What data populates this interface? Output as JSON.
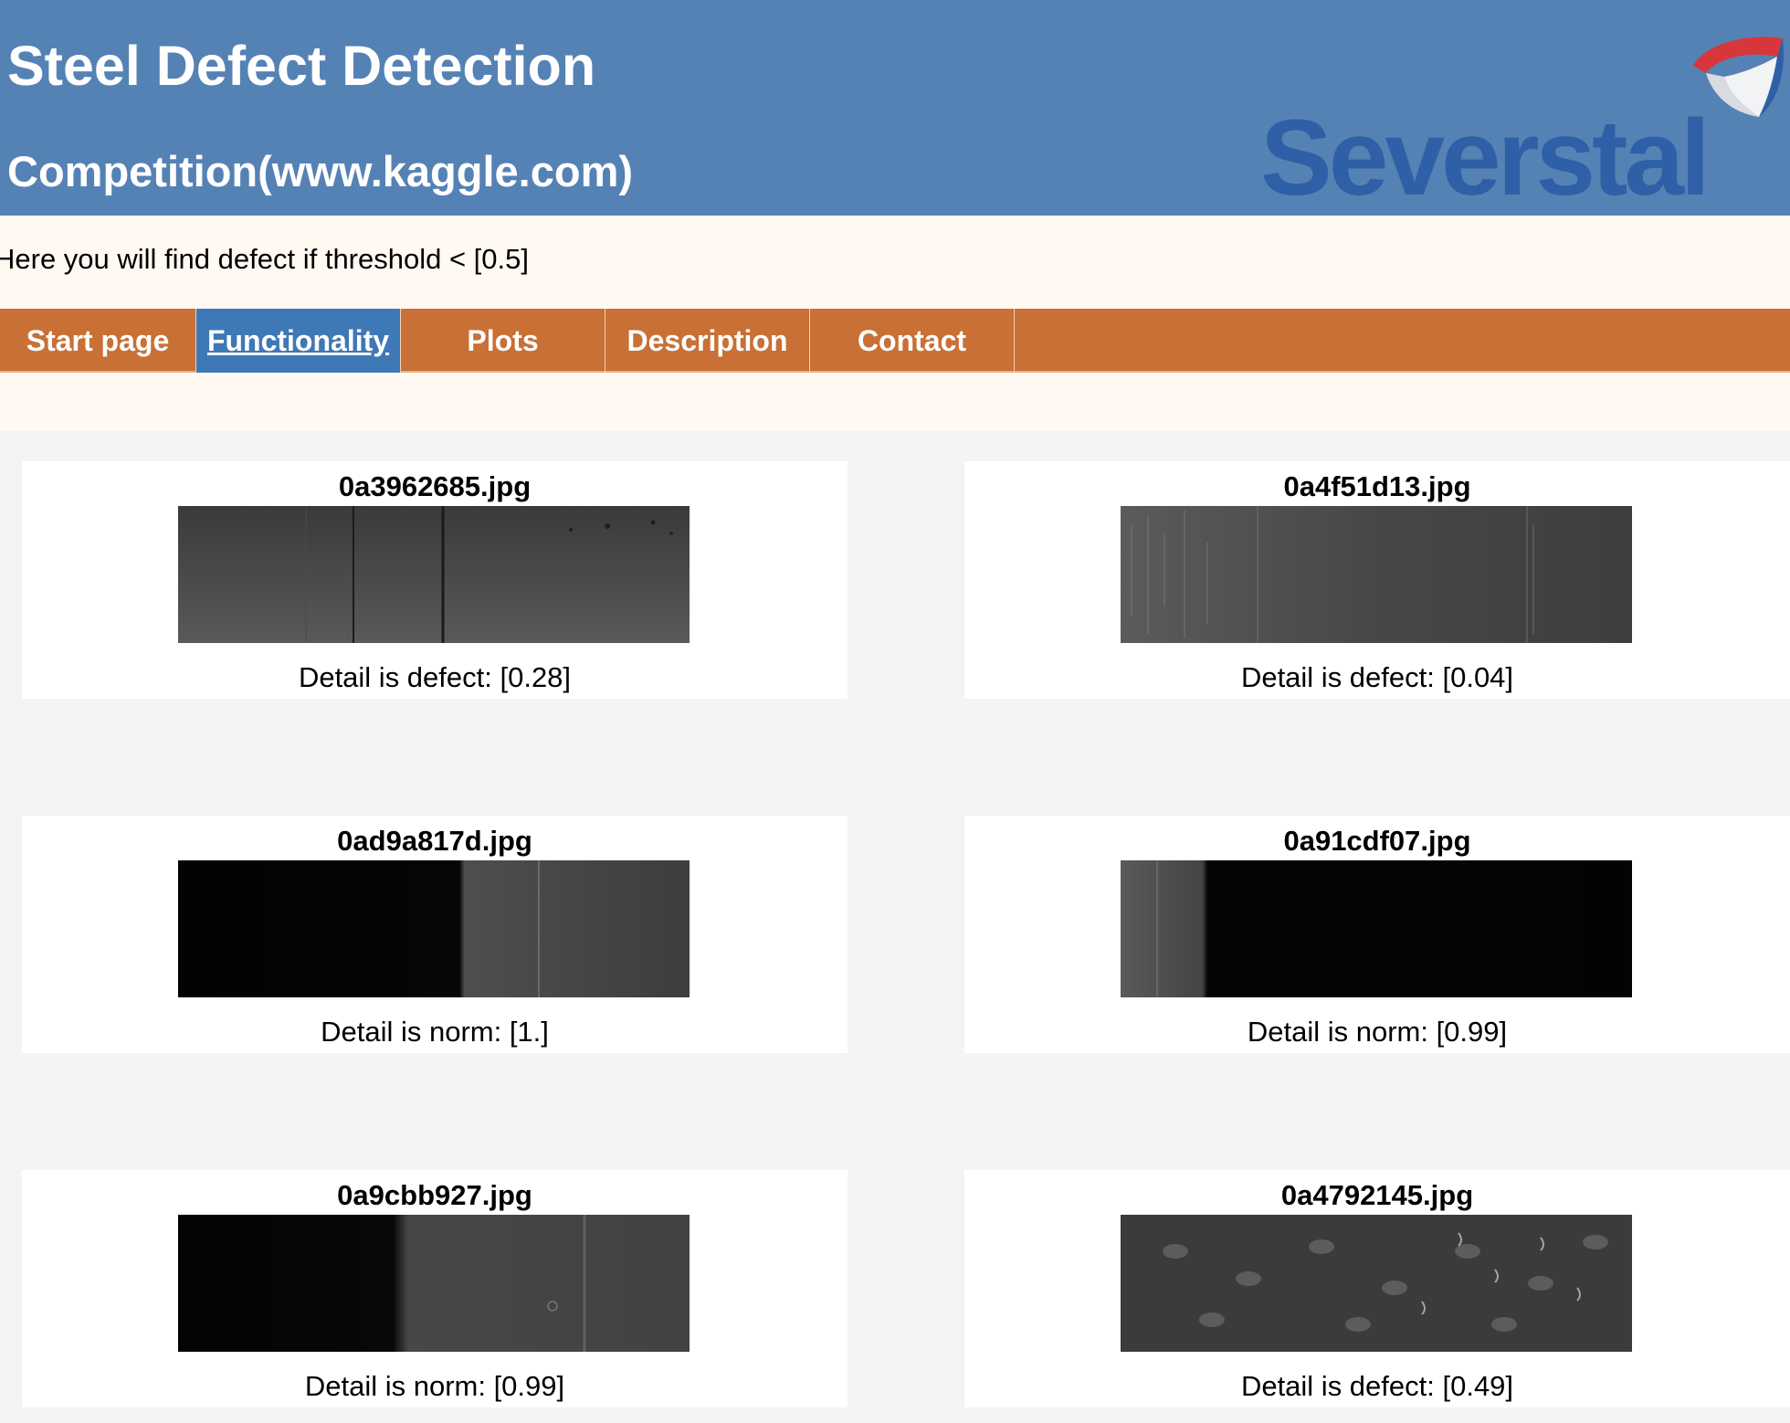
{
  "header": {
    "title": "Steel Defect Detection",
    "subtitle": "Competition(www.kaggle.com)",
    "logo_text": "Severstal",
    "background_color": "#5582b4"
  },
  "notice": {
    "text": "Here you will find defect if threshold < [0.5]"
  },
  "nav": {
    "items": [
      {
        "label": "Start page",
        "active": false
      },
      {
        "label": "Functionality",
        "active": true
      },
      {
        "label": "Plots",
        "active": false
      },
      {
        "label": "Description",
        "active": false
      },
      {
        "label": "Contact",
        "active": false
      }
    ],
    "background_color": "#c87035",
    "active_color": "#3f78b6"
  },
  "results": [
    {
      "filename": "0a3962685.jpg",
      "result": "Detail is defect: [0.28]",
      "image_style": "scratched-gray"
    },
    {
      "filename": "0a4f51d13.jpg",
      "result": "Detail is defect: [0.04]",
      "image_style": "speckled-gray"
    },
    {
      "filename": "0ad9a817d.jpg",
      "result": "Detail is norm: [1.]",
      "image_style": "dark-left-bright-right"
    },
    {
      "filename": "0a91cdf07.jpg",
      "result": "Detail is norm: [0.99]",
      "image_style": "bright-left-dark-right"
    },
    {
      "filename": "0a9cbb927.jpg",
      "result": "Detail is norm: [0.99]",
      "image_style": "dark-left-bright-right"
    },
    {
      "filename": "0a4792145.jpg",
      "result": "Detail is defect: [0.49]",
      "image_style": "dimpled-gray"
    }
  ]
}
